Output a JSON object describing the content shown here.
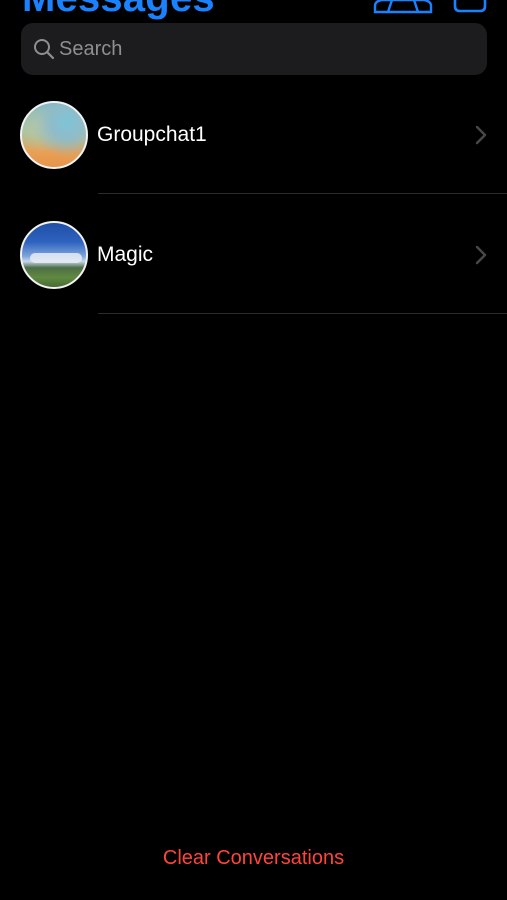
{
  "header": {
    "title": "Messages",
    "group_icon": "person-group-icon",
    "compose_icon": "compose-icon"
  },
  "search": {
    "placeholder": "Search",
    "value": ""
  },
  "conversations": [
    {
      "name": "Groupchat1",
      "avatar": "gradient-sky-photo"
    },
    {
      "name": "Magic",
      "avatar": "landscape-sky-photo"
    }
  ],
  "footer": {
    "clear_label": "Clear Conversations"
  },
  "colors": {
    "accent": "#1a82ff",
    "destructive": "#ff453a",
    "background": "#000000",
    "search_bg": "#1c1c1e",
    "placeholder": "#8e8e93"
  }
}
